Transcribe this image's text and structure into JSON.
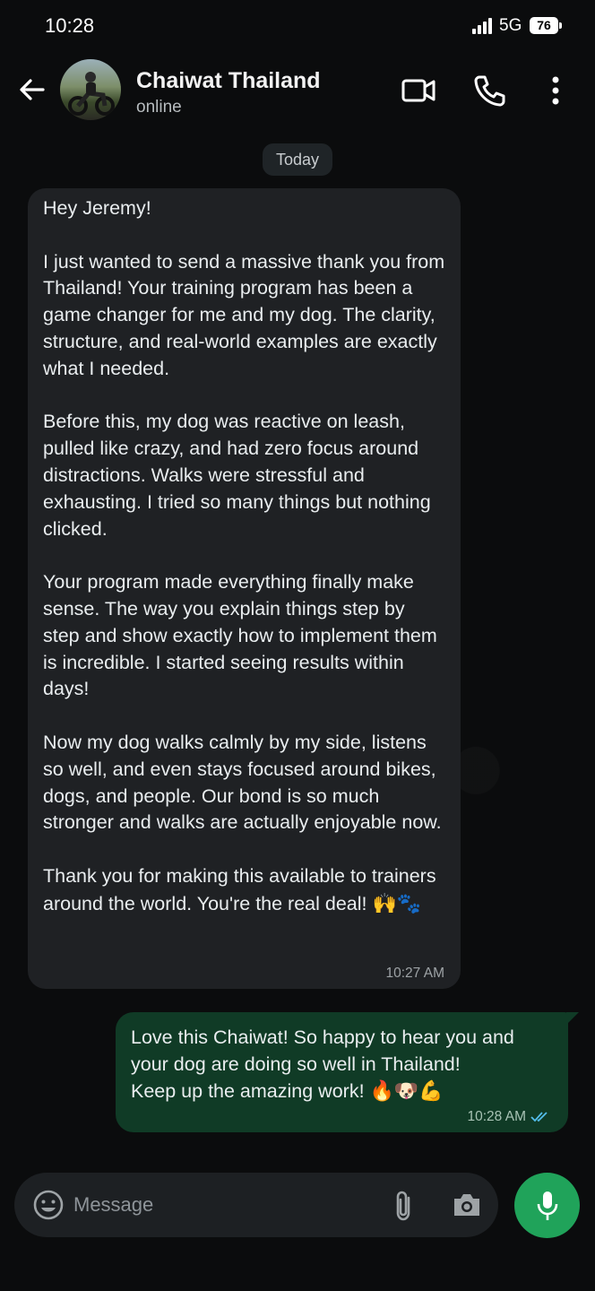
{
  "status_bar": {
    "time": "10:28",
    "network": "5G",
    "battery": "76"
  },
  "header": {
    "contact_name": "Chaiwat Thailand",
    "contact_status": "online",
    "icons": [
      "back-arrow-icon",
      "video-call-icon",
      "phone-icon",
      "more-vert-icon"
    ]
  },
  "day_chip": "Today",
  "messages": [
    {
      "direction": "incoming",
      "paragraphs": [
        "Hey Jeremy!",
        "I just wanted to send a massive thank you from Thailand! Your training program has been a game changer for me and my dog. The clarity, structure, and real-world examples are exactly what I needed.",
        "Before this, my dog was reactive on leash, pulled like crazy, and had zero focus around distractions. Walks were stressful and exhausting. I tried so many things but nothing clicked.",
        "Your program made everything finally make sense. The way you explain things step by step and show exactly how to implement them is incredible. I started seeing results within days!",
        "Now my dog walks calmly by my side, listens so well, and even stays focused around bikes, dogs, and people. Our bond is so much stronger and walks are actually enjoyable now.",
        "Thank you for making this available to trainers around the world. You're the real deal!"
      ],
      "emojis": "🙌🐾",
      "time": "10:27 AM"
    },
    {
      "direction": "outgoing",
      "lines": [
        "Love this Chaiwat! So happy to hear you and your dog are doing so well in Thailand!",
        "Keep up the amazing work!"
      ],
      "emojis": "🔥🐶💪",
      "time": "10:28 AM",
      "read_status": "double-check-icon"
    }
  ],
  "composer": {
    "placeholder": "Message",
    "icons": [
      "emoji-icon",
      "attach-icon",
      "camera-icon",
      "mic-icon"
    ]
  },
  "colors": {
    "background": "#0b0c0d",
    "incoming_bubble": "#1f2124",
    "outgoing_bubble": "#103b26",
    "accent_green": "#20a35a",
    "read_tick": "#53bdeb"
  }
}
